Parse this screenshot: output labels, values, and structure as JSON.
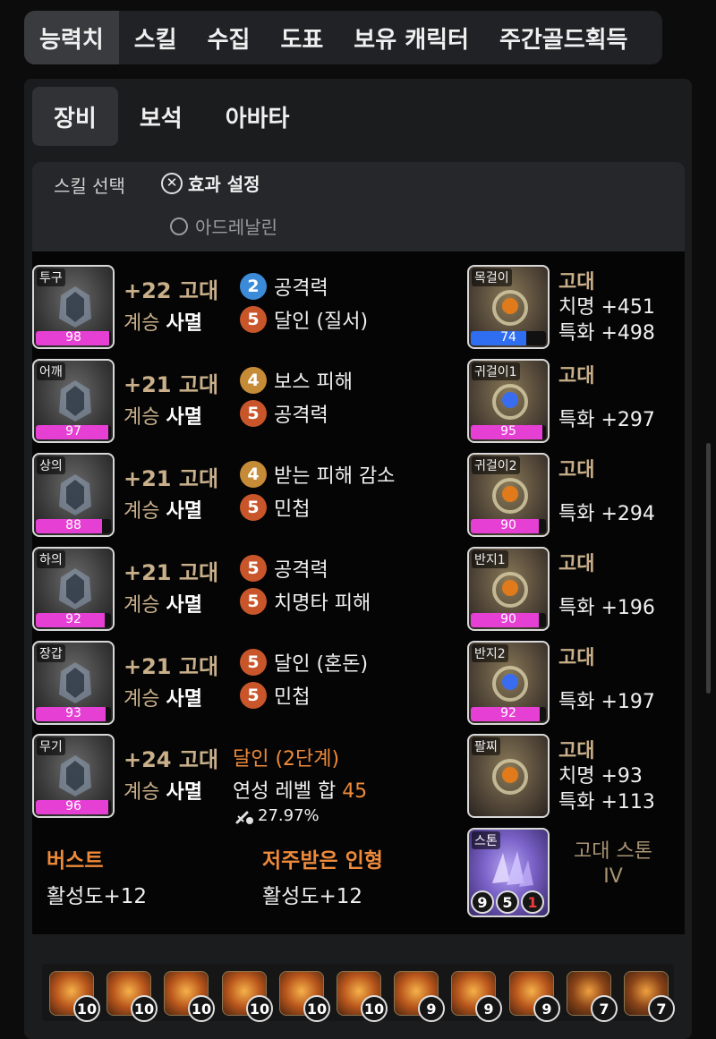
{
  "top_tabs": [
    "능력치",
    "스킬",
    "수집",
    "도표",
    "보유 캐릭터",
    "주간골드획득"
  ],
  "sub_tabs": [
    "장비",
    "보석",
    "아바타"
  ],
  "skill_select": {
    "label": "스킬 선택",
    "effect_button": "효과 설정",
    "option": "아드레날린"
  },
  "equipment": [
    {
      "slot": "투구",
      "quality": 98,
      "line1": "+22 고대",
      "succ_prefix": "계승",
      "succ": "사멸",
      "effects": [
        {
          "level": "2",
          "color": "blue",
          "name": "공격력"
        },
        {
          "level": "5",
          "color": "orange",
          "name": "달인 (질서)"
        }
      ]
    },
    {
      "slot": "어깨",
      "quality": 97,
      "line1": "+21 고대",
      "succ_prefix": "계승",
      "succ": "사멸",
      "effects": [
        {
          "level": "4",
          "color": "gold",
          "name": "보스 피해"
        },
        {
          "level": "5",
          "color": "orange",
          "name": "공격력"
        }
      ]
    },
    {
      "slot": "상의",
      "quality": 88,
      "line1": "+21 고대",
      "succ_prefix": "계승",
      "succ": "사멸",
      "effects": [
        {
          "level": "4",
          "color": "gold",
          "name": "받는 피해 감소"
        },
        {
          "level": "5",
          "color": "orange",
          "name": "민첩"
        }
      ]
    },
    {
      "slot": "하의",
      "quality": 92,
      "line1": "+21 고대",
      "succ_prefix": "계승",
      "succ": "사멸",
      "effects": [
        {
          "level": "5",
          "color": "orange",
          "name": "공격력"
        },
        {
          "level": "5",
          "color": "orange",
          "name": "치명타 피해"
        }
      ]
    },
    {
      "slot": "장갑",
      "quality": 93,
      "line1": "+21 고대",
      "succ_prefix": "계승",
      "succ": "사멸",
      "effects": [
        {
          "level": "5",
          "color": "orange",
          "name": "달인 (혼돈)"
        },
        {
          "level": "5",
          "color": "orange",
          "name": "민첩"
        }
      ]
    },
    {
      "slot": "무기",
      "quality": 96,
      "line1": "+24 고대",
      "succ_prefix": "계승",
      "succ": "사멸",
      "effects": []
    }
  ],
  "weapon_extra": {
    "line1": "달인 (2단계)",
    "line2_label": "연성 레벨 합",
    "line2_value": "45",
    "line3": "27.97%"
  },
  "accessories": [
    {
      "slot": "목걸이",
      "quality": 74,
      "grade": "고대",
      "stats": [
        "치명 +451",
        "특화 +498"
      ]
    },
    {
      "slot": "귀걸이1",
      "quality": 95,
      "grade": "고대",
      "stats": [
        "특화 +297"
      ]
    },
    {
      "slot": "귀걸이2",
      "quality": 90,
      "grade": "고대",
      "stats": [
        "특화 +294"
      ]
    },
    {
      "slot": "반지1",
      "quality": 90,
      "grade": "고대",
      "stats": [
        "특화 +196"
      ]
    },
    {
      "slot": "반지2",
      "quality": 92,
      "grade": "고대",
      "stats": [
        "특화 +197"
      ]
    },
    {
      "slot": "팔찌",
      "quality": null,
      "grade": "고대",
      "stats": [
        "치명 +93",
        "특화 +113"
      ]
    }
  ],
  "bracelet_effects": [
    {
      "title": "버스트",
      "value": "활성도+12"
    },
    {
      "title": "저주받은 인형",
      "value": "활성도+12"
    }
  ],
  "stone": {
    "slot": "스톤",
    "values": [
      "9",
      "5",
      "1"
    ],
    "name_line1": "고대 스톤",
    "name_line2": "IV"
  },
  "gems": [
    "10",
    "10",
    "10",
    "10",
    "10",
    "10",
    "9",
    "9",
    "9",
    "7",
    "7"
  ],
  "colors": {
    "quality_pink": "#e53fd3",
    "quality_blue": "#2f6ef0",
    "grade_text": "#c9b08a",
    "accent_orange": "#ee8a3a"
  }
}
